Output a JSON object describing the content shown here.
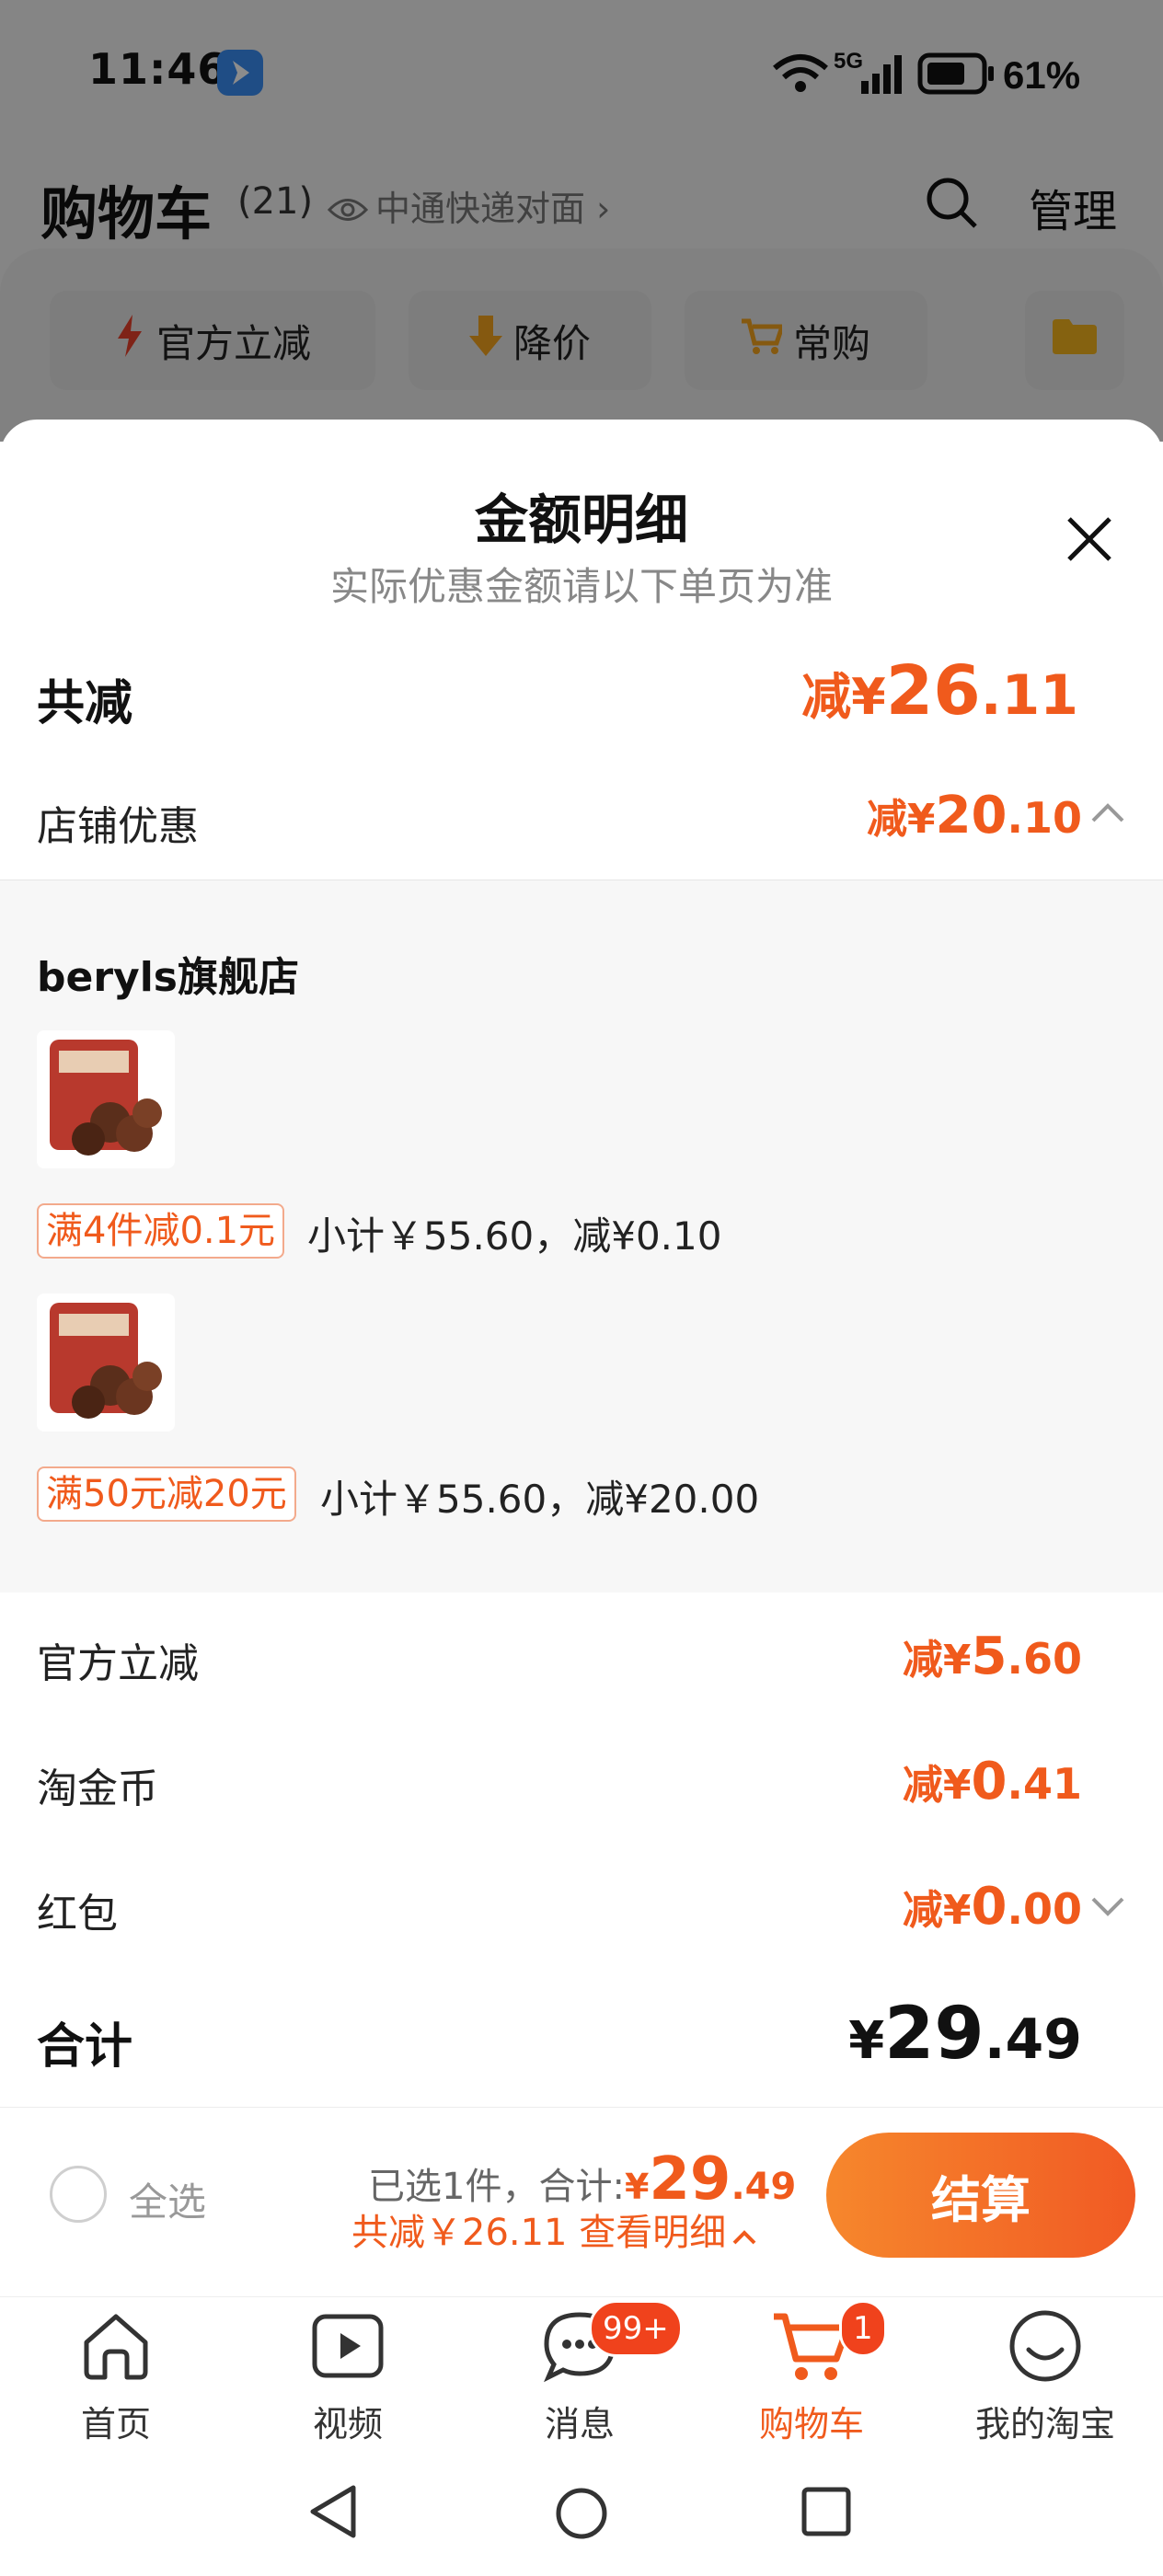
{
  "status_bar": {
    "time": "11:46",
    "network": "5G",
    "battery": "61%"
  },
  "header": {
    "title": "购物车",
    "count": "(21)",
    "address": "中通快递对面",
    "manage": "管理"
  },
  "filters": [
    "官方立减",
    "降价",
    "常购"
  ],
  "sheet": {
    "title": "金额明细",
    "subtitle": "实际优惠金额请以下单页为准",
    "total_discount": {
      "label": "共减",
      "prefix": "减¥",
      "int": "26",
      "dec": ".11"
    },
    "store_discount": {
      "label": "店铺优惠",
      "prefix": "减¥",
      "int": "20",
      "dec": ".10"
    },
    "store": {
      "name": "beryls旗舰店",
      "items": [
        {
          "tag": "满4件减0.1元",
          "subtotal": "小计￥55.60，减¥0.10"
        },
        {
          "tag": "满50元减20元",
          "subtotal": "小计￥55.60，减¥20.00"
        }
      ]
    },
    "official_discount": {
      "label": "官方立减",
      "prefix": "减¥",
      "int": "5",
      "dec": ".60"
    },
    "coins": {
      "label": "淘金币",
      "prefix": "减¥",
      "int": "0",
      "dec": ".41"
    },
    "red_packet": {
      "label": "红包",
      "prefix": "减¥",
      "int": "0",
      "dec": ".00"
    },
    "total": {
      "label": "合计",
      "prefix": "¥",
      "int": "29",
      "dec": ".49"
    }
  },
  "checkout": {
    "select_all": "全选",
    "selected_info": "已选1件，合计:",
    "price_prefix": "¥",
    "price_int": "29",
    "price_dec": ".49",
    "saved_text": "共减￥26.11 查看明细",
    "pay": "结算"
  },
  "tabs": [
    {
      "label": "首页",
      "icon": "home-icon"
    },
    {
      "label": "视频",
      "icon": "video-icon"
    },
    {
      "label": "消息",
      "icon": "message-icon",
      "badge": "99+"
    },
    {
      "label": "购物车",
      "icon": "cart-icon",
      "badge": "1"
    },
    {
      "label": "我的淘宝",
      "icon": "smile-icon"
    }
  ],
  "colors": {
    "accent": "#f05a1c",
    "button_start": "#f6872c",
    "button_end": "#f15a24"
  }
}
